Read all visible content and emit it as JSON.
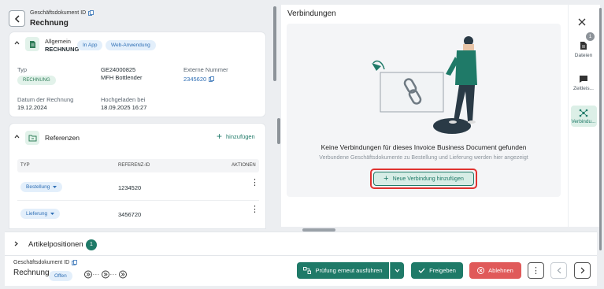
{
  "header": {
    "doc_type_label": "Geschäftsdokument ID",
    "doc_title": "Rechnung"
  },
  "general": {
    "section_label": "Allgemein",
    "section_value": "RECHNUNG",
    "chip_app": "In App",
    "chip_web": "Web-Anwendung",
    "typ_label": "Typ",
    "typ_value": "RECHNUNG",
    "number": "GE24000825",
    "company": "MFH Bottlender",
    "external_label": "Externe Nummer",
    "external_value": "2345620",
    "date_label": "Datum der Rechnung",
    "date_value": "19.12.2024",
    "uploaded_label": "Hochgeladen bei",
    "uploaded_value": "18.09.2025 16:27"
  },
  "references": {
    "title": "Referenzen",
    "add_label": "hinzufügen",
    "col_type": "TYP",
    "col_id": "REFERENZ-ID",
    "col_actions": "AKTIONEN",
    "rows": [
      {
        "type": "Bestellung",
        "id": "1234520"
      },
      {
        "type": "Lieferung",
        "id": "3456720"
      }
    ]
  },
  "connections": {
    "title": "Verbindungen",
    "empty_title": "Keine Verbindungen für dieses Invoice Business Document gefunden",
    "empty_subtitle": "Verbundene Geschäftsdokumente zu Bestellung und Lieferung werden hier angezeigt",
    "add_button": "Neue Verbindung hinzufügen"
  },
  "rail": {
    "files": "Dateien",
    "files_badge": "1",
    "timeline": "Zeitleis...",
    "connections": "Verbindu..."
  },
  "articles": {
    "title": "Artikelpositionen",
    "count": "1"
  },
  "footer": {
    "doc_type_label": "Geschäftsdokument ID",
    "doc_title": "Rechnung",
    "status": "Offen",
    "recheck": "Prüfung erneut ausführen",
    "approve": "Freigeben",
    "reject": "Ablehnen"
  },
  "colors": {
    "teal": "#1f7a68",
    "red": "#e05a5a",
    "highlight": "#e0322f"
  }
}
